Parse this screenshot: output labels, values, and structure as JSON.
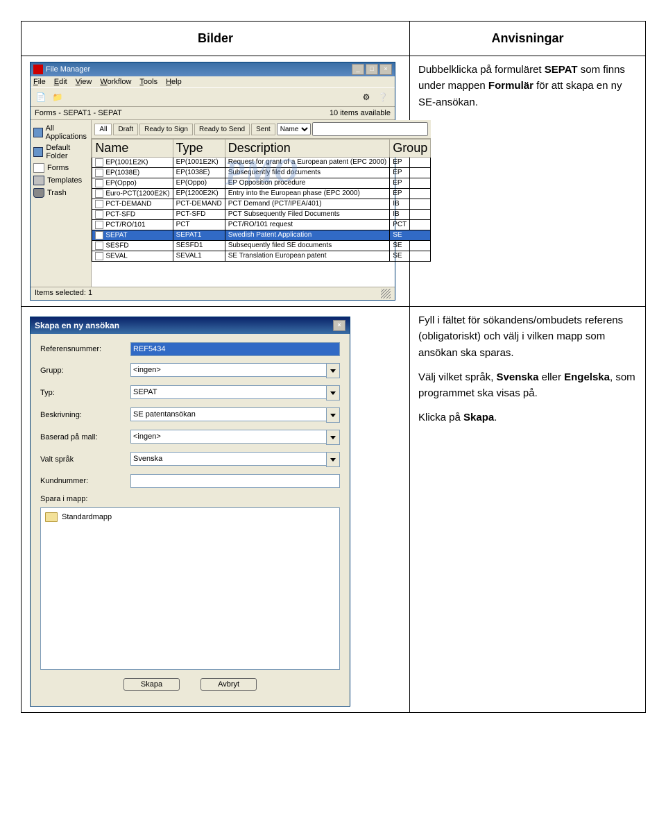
{
  "headers": {
    "bilder": "Bilder",
    "anvisningar": "Anvisningar"
  },
  "instr1": {
    "p1a": "Dubbelklicka på formuläret ",
    "p1b": "SEPAT",
    "p1c": " som finns under mappen ",
    "p1d": "Formulär",
    "p1e": " för att skapa en ny SE-ansökan."
  },
  "instr2": {
    "p1": "Fyll i fältet för sökandens/ombudets referens (obligatoriskt) och välj i vilken mapp som ansökan ska sparas.",
    "p2a": "Välj vilket språk, ",
    "p2b": "Svenska",
    "p2c": " eller ",
    "p2d": "Engelska",
    "p2e": ", som programmet ska visas på.",
    "p3a": "Klicka på ",
    "p3b": "Skapa",
    "p3c": "."
  },
  "fm": {
    "title": "File Manager",
    "menu": {
      "file": "File",
      "edit": "Edit",
      "view": "View",
      "workflow": "Workflow",
      "tools": "Tools",
      "help": "Help"
    },
    "breadcrumb": "Forms - SEPAT1 - SEPAT",
    "items_avail": "10 items available",
    "sidebar": {
      "all": "All Applications",
      "default": "Default Folder",
      "forms": "Forms",
      "templates": "Templates",
      "trash": "Trash"
    },
    "filters": {
      "all": "All",
      "draft": "Draft",
      "ready_sign": "Ready to Sign",
      "ready_send": "Ready to Send",
      "sent": "Sent",
      "name_field": "Name"
    },
    "cols": {
      "name": "Name",
      "type": "Type",
      "desc": "Description",
      "group": "Group"
    },
    "watermark": "PMO",
    "rows": [
      {
        "name": "EP(1001E2K)",
        "type": "EP(1001E2K)",
        "desc": "Request for grant of a European patent (EPC 2000)",
        "group": "EP"
      },
      {
        "name": "EP(1038E)",
        "type": "EP(1038E)",
        "desc": "Subsequently filed documents",
        "group": "EP"
      },
      {
        "name": "EP(Oppo)",
        "type": "EP(Oppo)",
        "desc": "EP Opposition procedure",
        "group": "EP"
      },
      {
        "name": "Euro-PCT(1200E2K)",
        "type": "EP(1200E2K)",
        "desc": "Entry into the European phase (EPC 2000)",
        "group": "EP"
      },
      {
        "name": "PCT-DEMAND",
        "type": "PCT-DEMAND",
        "desc": "PCT Demand (PCT/IPEA/401)",
        "group": "IB"
      },
      {
        "name": "PCT-SFD",
        "type": "PCT-SFD",
        "desc": "PCT Subsequently Filed Documents",
        "group": "IB"
      },
      {
        "name": "PCT/RO/101",
        "type": "PCT",
        "desc": "PCT/RO/101 request",
        "group": "PCT"
      },
      {
        "name": "SEPAT",
        "type": "SEPAT1",
        "desc": "Swedish Patent Application",
        "group": "SE",
        "sel": true
      },
      {
        "name": "SESFD",
        "type": "SESFD1",
        "desc": "Subsequently filed SE documents",
        "group": "SE"
      },
      {
        "name": "SEVAL",
        "type": "SEVAL1",
        "desc": "SE Translation European patent",
        "group": "SE"
      }
    ],
    "status": "Items selected: 1"
  },
  "dlg": {
    "title": "Skapa en ny ansökan",
    "labels": {
      "ref": "Referensnummer:",
      "grupp": "Grupp:",
      "typ": "Typ:",
      "beskr": "Beskrivning:",
      "mall": "Baserad på mall:",
      "sprak": "Valt språk",
      "kund": "Kundnummer:",
      "spara": "Spara i mapp:"
    },
    "values": {
      "ref": "REF5434",
      "grupp": "<ingen>",
      "typ": "SEPAT",
      "beskr": "SE patentansökan",
      "mall": "<ingen>",
      "sprak": "Svenska",
      "kund": ""
    },
    "folder": "Standardmapp",
    "buttons": {
      "skapa": "Skapa",
      "avbryt": "Avbryt"
    }
  }
}
